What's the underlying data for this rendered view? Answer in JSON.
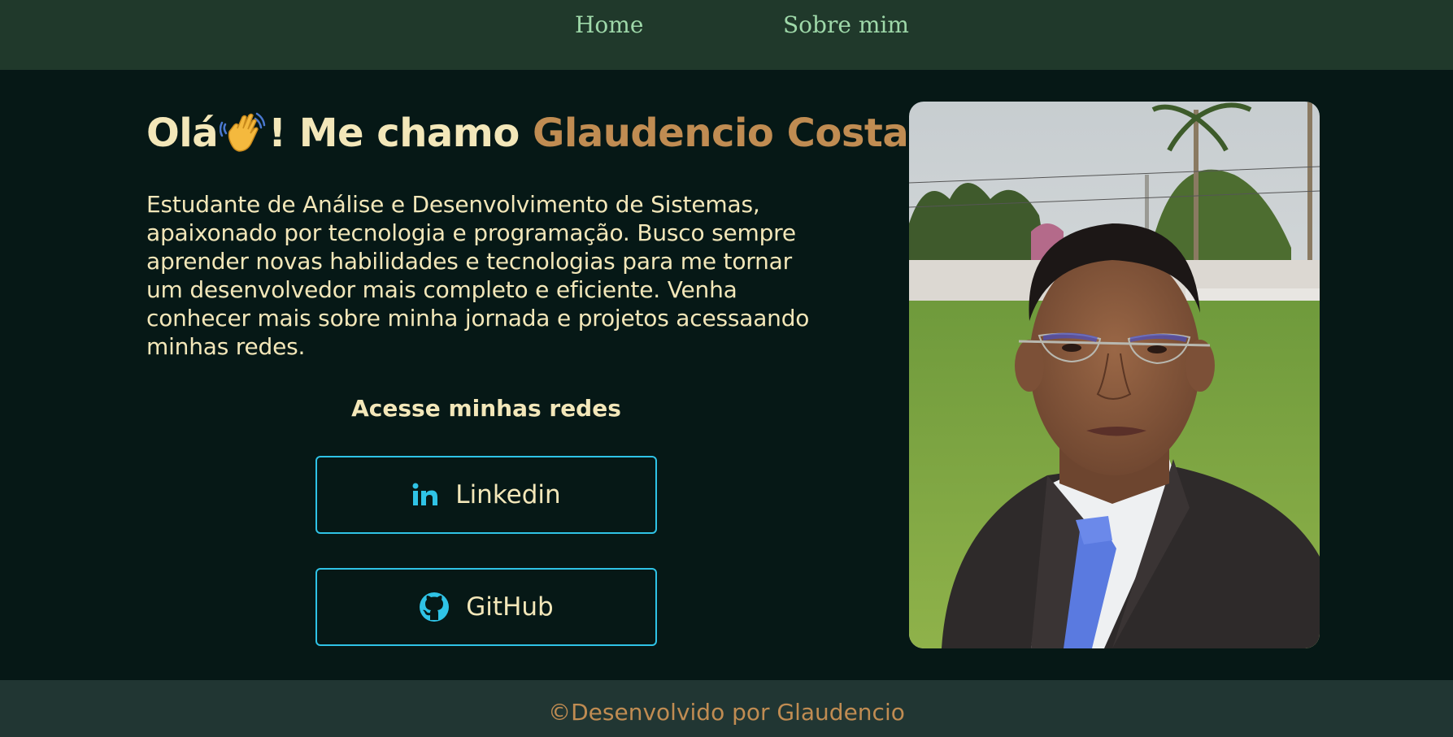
{
  "nav": {
    "home_label": "Home",
    "about_label": "Sobre mim"
  },
  "hero": {
    "greeting": "Olá",
    "greeting_rest": "! Me chamo ",
    "name": "Glaudencio Costa",
    "wave_icon": "waving-hand-emoji",
    "intro": "Estudante de Análise e Desenvolvimento de Sistemas, apaixonado por tecnologia e programação. Busco sempre aprender novas habilidades e tecnologias para me tornar um desenvolvedor mais completo e eficiente. Venha conhecer mais sobre minha jornada e projetos acessaando minhas redes."
  },
  "socials": {
    "heading": "Acesse minhas redes",
    "linkedin_label": "Linkedin",
    "github_label": "GitHub"
  },
  "footer": {
    "text": "©Desenvolvido por Glaudencio"
  },
  "colors": {
    "background": "#061816",
    "header": "#20392b",
    "footer": "#213633",
    "text": "#f3e7b9",
    "accent": "#c08c52",
    "nav_link": "#9ed8a9",
    "button_border": "#2fc3e6"
  }
}
